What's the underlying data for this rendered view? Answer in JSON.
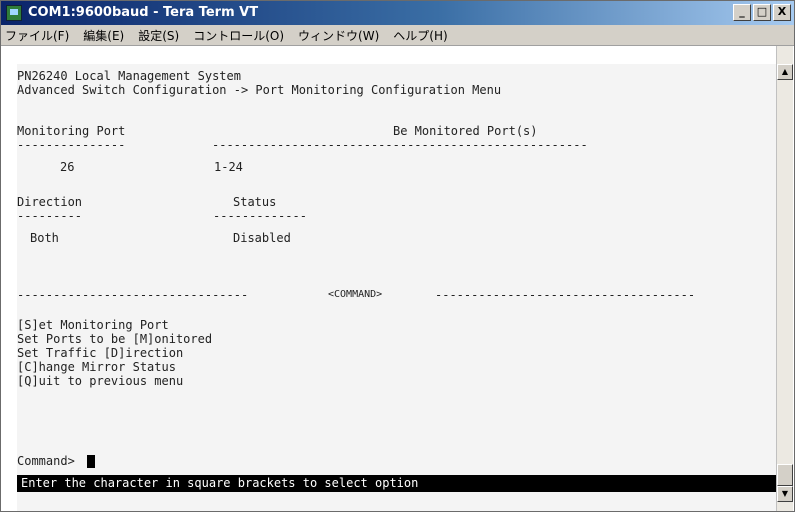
{
  "window": {
    "title": "COM1:9600baud - Tera Term VT",
    "buttons": [
      "_",
      "□",
      "X"
    ]
  },
  "menu": [
    "ファイル(F)",
    "編集(E)",
    "設定(S)",
    "コントロール(O)",
    "ウィンドウ(W)",
    "ヘルプ(H)"
  ],
  "terminal": {
    "system": "PN26240 Local Management System",
    "breadcrumb": "Advanced Switch Configuration -> Port Monitoring Configuration Menu",
    "monitoring_port_header": "Monitoring Port",
    "monitored_ports_header": "Be Monitored Port(s)",
    "dash_short": "---------------",
    "dash_long": "----------------------------------------------------",
    "monitoring_port_value": "26",
    "monitored_ports_value": "1-24",
    "direction_header": "Direction",
    "status_header": "Status",
    "direction_dash": "---------",
    "status_dash": "-------------",
    "direction_value": "Both",
    "status_value": "Disabled",
    "command_left": "--------------------------------",
    "command_label": "<COMMAND>",
    "command_right": "------------------------------------",
    "options": [
      "[S]et Monitoring Port",
      "Set Ports to be [M]onitored",
      "Set Traffic [D]irection",
      "[C]hange Mirror Status",
      "[Q]uit to previous menu"
    ],
    "prompt": "Command>",
    "status_message": "Enter the character in square brackets to select option"
  },
  "icons": {
    "app": "tera-term-icon",
    "scroll_up": "scroll-up-arrow-icon",
    "scroll_down": "scroll-down-arrow-icon"
  }
}
